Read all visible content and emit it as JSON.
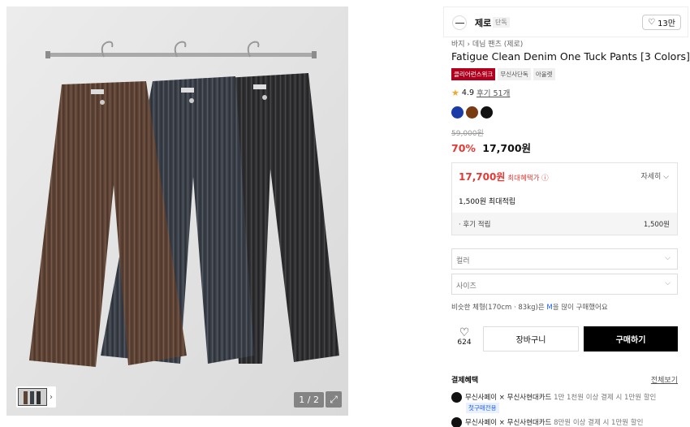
{
  "gallery": {
    "counter": "1 / 2",
    "expand_icon": "expand-icon",
    "thumb_arrow": "›"
  },
  "brand": {
    "name": "제로",
    "badge": "단독",
    "likes": "13만"
  },
  "product": {
    "breadcrumb": "바지 › 데님 팬츠 (제로)",
    "title": "Fatigue Clean Denim One Tuck Pants [3 Colors]",
    "tags": [
      "클리어런스위크",
      "무신사단독",
      "아울렛"
    ],
    "rating": "4.9",
    "reviews": "후기 51개",
    "colors": [
      "#1a3aa8",
      "#7a3b10",
      "#111111"
    ],
    "original_price": "59,000원",
    "discount": "70%",
    "price": "17,700원"
  },
  "benefit": {
    "max_price": "17,700원",
    "max_label": "최대혜택가 ⓘ",
    "detail": "자세히 ⌵",
    "points_line": "1,500원 최대적립",
    "review_points_label": "· 후기 적립",
    "review_points_value": "1,500원"
  },
  "options": {
    "color_placeholder": "컬러",
    "size_placeholder": "사이즈"
  },
  "fit_note": {
    "pre": "비슷한 체형(170cm · 83kg)은 ",
    "size": "M",
    "post": "을 많이 구매했어요"
  },
  "actions": {
    "like_count": "624",
    "cart": "장바구니",
    "buy": "구매하기"
  },
  "payment": {
    "title": "결제혜택",
    "all": "전체보기",
    "items": [
      {
        "name": "무신사페이 × 무신사현대카드",
        "desc": " 1만 1천원 이상 결제 시 1만원 할인"
      },
      {
        "name": "무신사페이 × 무신사현대카드",
        "desc": " 8만원 이상 결제 시 1만원 할인"
      }
    ],
    "badge": "첫구매전용"
  }
}
